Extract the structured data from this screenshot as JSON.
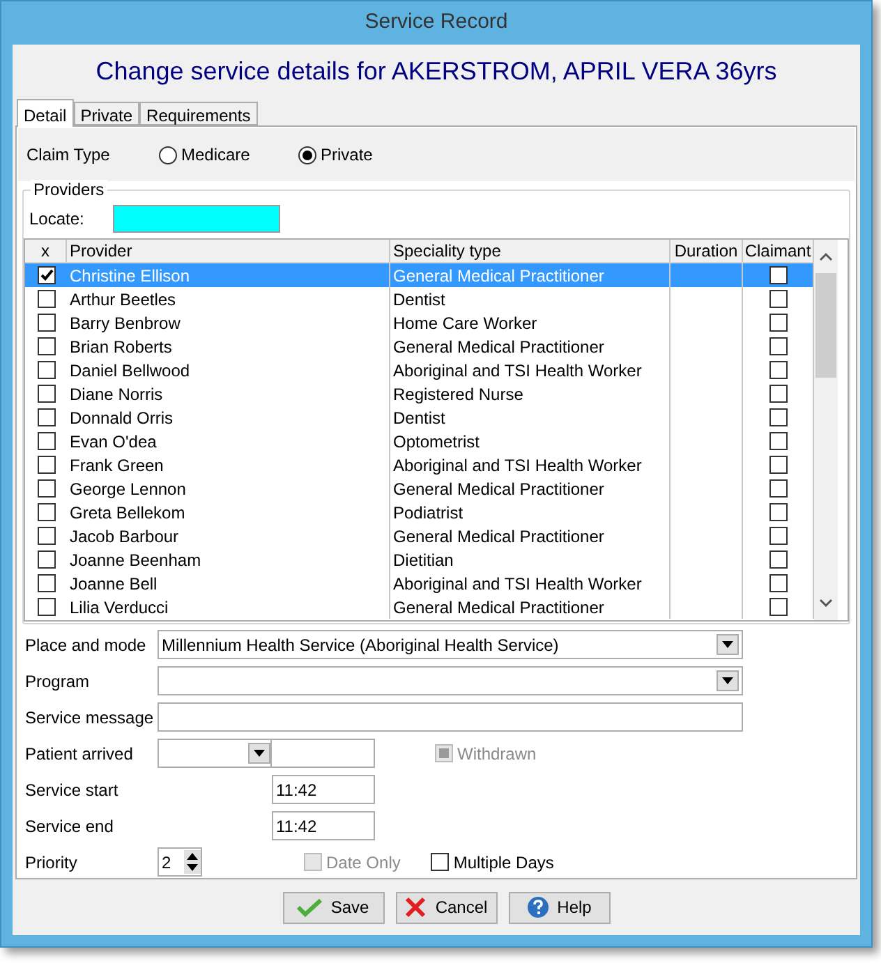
{
  "window": {
    "title": "Service Record"
  },
  "heading": "Change service details for AKERSTROM, APRIL VERA 36yrs",
  "tabs": [
    {
      "label": "Detail",
      "selected": true
    },
    {
      "label": "Private",
      "selected": false
    },
    {
      "label": "Requirements",
      "selected": false
    }
  ],
  "claim_type": {
    "label": "Claim Type",
    "options": [
      {
        "label": "Medicare",
        "selected": false
      },
      {
        "label": "Private",
        "selected": true
      }
    ]
  },
  "providers": {
    "group_label": "Providers",
    "locate_label": "Locate:"
  },
  "table": {
    "columns": [
      "x",
      "Provider",
      "Speciality type",
      "Duration",
      "Claimant"
    ],
    "rows": [
      {
        "selected": true,
        "checked": true,
        "provider": "Christine Ellison",
        "speciality": "General Medical Practitioner",
        "claimant": false
      },
      {
        "selected": false,
        "checked": false,
        "provider": "Arthur Beetles",
        "speciality": "Dentist",
        "claimant": false
      },
      {
        "selected": false,
        "checked": false,
        "provider": "Barry Benbrow",
        "speciality": "Home Care Worker",
        "claimant": false
      },
      {
        "selected": false,
        "checked": false,
        "provider": "Brian Roberts",
        "speciality": "General Medical Practitioner",
        "claimant": false
      },
      {
        "selected": false,
        "checked": false,
        "provider": "Daniel Bellwood",
        "speciality": "Aboriginal and TSI Health Worker",
        "claimant": false
      },
      {
        "selected": false,
        "checked": false,
        "provider": "Diane Norris",
        "speciality": "Registered Nurse",
        "claimant": false
      },
      {
        "selected": false,
        "checked": false,
        "provider": "Donnald Orris",
        "speciality": "Dentist",
        "claimant": false
      },
      {
        "selected": false,
        "checked": false,
        "provider": "Evan O'dea",
        "speciality": "Optometrist",
        "claimant": false
      },
      {
        "selected": false,
        "checked": false,
        "provider": "Frank Green",
        "speciality": "Aboriginal and TSI Health Worker",
        "claimant": false
      },
      {
        "selected": false,
        "checked": false,
        "provider": "George Lennon",
        "speciality": "General Medical Practitioner",
        "claimant": false
      },
      {
        "selected": false,
        "checked": false,
        "provider": "Greta Bellekom",
        "speciality": "Podiatrist",
        "claimant": false
      },
      {
        "selected": false,
        "checked": false,
        "provider": "Jacob Barbour",
        "speciality": "General Medical Practitioner",
        "claimant": false
      },
      {
        "selected": false,
        "checked": false,
        "provider": "Joanne Beenham",
        "speciality": "Dietitian",
        "claimant": false
      },
      {
        "selected": false,
        "checked": false,
        "provider": "Joanne Bell",
        "speciality": "Aboriginal and TSI Health Worker",
        "claimant": false
      },
      {
        "selected": false,
        "checked": false,
        "provider": "Lilia Verducci",
        "speciality": "General Medical Practitioner",
        "claimant": false
      }
    ]
  },
  "place_and_mode": {
    "label": "Place and mode",
    "value": "Millennium Health Service (Aboriginal Health Service)"
  },
  "program": {
    "label": "Program"
  },
  "service_message": {
    "label": "Service message"
  },
  "patient_arrived": {
    "label": "Patient arrived"
  },
  "withdrawn": {
    "label": "Withdrawn",
    "checked": true,
    "disabled": true
  },
  "service_start": {
    "label": "Service start",
    "value": "11:42"
  },
  "service_end": {
    "label": "Service end",
    "value": "11:42"
  },
  "priority": {
    "label": "Priority",
    "value": "2"
  },
  "date_only": {
    "label": "Date Only",
    "checked": false,
    "disabled": true
  },
  "multiple_days": {
    "label": "Multiple Days",
    "checked": false,
    "disabled": false
  },
  "buttons": [
    {
      "label": "Save",
      "kind": "save"
    },
    {
      "label": "Cancel",
      "kind": "cancel"
    },
    {
      "label": "Help",
      "kind": "help"
    }
  ]
}
